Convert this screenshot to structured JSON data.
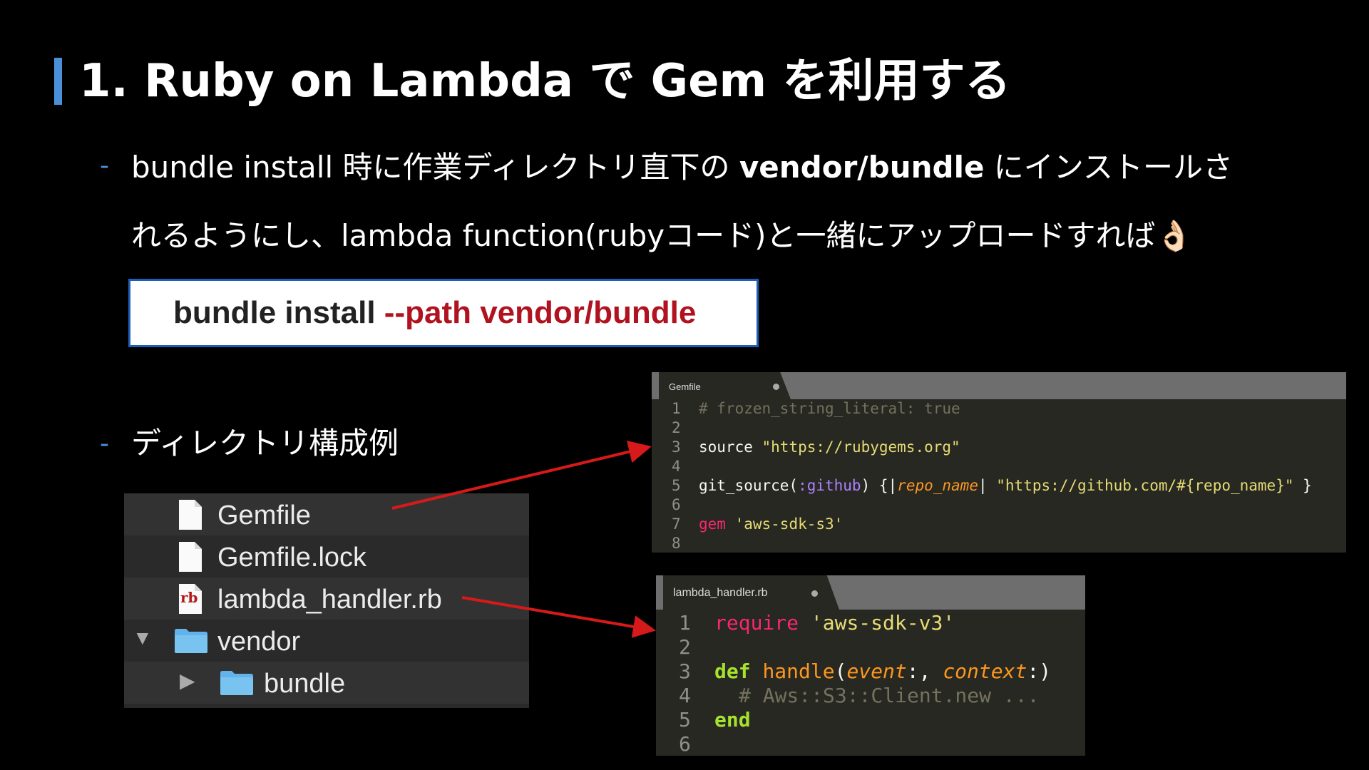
{
  "slide": {
    "title": "1. Ruby on Lambda で Gem を利用する",
    "bullet_dash": "-",
    "bullet1_line1_pre": "bundle install 時に作業ディレクトリ直下の ",
    "bullet1_line1_bold": "vendor/bundle",
    "bullet1_line1_post": " にインストールさ",
    "bullet1_line2": "れるようにし、lambda function(rubyコード)と一緒にアップロードすれば👌🏻",
    "command_base": "bundle install ",
    "command_option": "--path vendor/bundle",
    "bullet2": "ディレクトリ構成例"
  },
  "tree": {
    "items": [
      {
        "label": "Gemfile",
        "icon": "file-icon"
      },
      {
        "label": "Gemfile.lock",
        "icon": "file-icon"
      },
      {
        "label": "lambda_handler.rb",
        "icon": "ruby-file-icon",
        "badge": "rb"
      },
      {
        "label": "vendor",
        "icon": "folder-icon",
        "disclosure": "▼"
      },
      {
        "label": "bundle",
        "icon": "folder-icon",
        "disclosure": "▶"
      }
    ]
  },
  "gemfile_editor": {
    "tab_title": "Gemfile",
    "line_numbers": [
      "1",
      "2",
      "3",
      "4",
      "5",
      "6",
      "7",
      "8"
    ],
    "line1": "# frozen_string_literal: true",
    "line3_kw": "source",
    "line3_str": "\"https://rubygems.org\"",
    "line5_fn": "git_source(",
    "line5_sym": ":github",
    "line5_mid": ") {|",
    "line5_arg": "repo_name",
    "line5_pipe": "| ",
    "line5_str": "\"https://github.com/#{repo_name}\"",
    "line5_end": " }",
    "line7_kw": "gem",
    "line7_str": "'aws-sdk-s3'"
  },
  "handler_editor": {
    "tab_title": "lambda_handler.rb",
    "line_numbers": [
      "1",
      "2",
      "3",
      "4",
      "5",
      "6"
    ],
    "line1_kw": "require",
    "line1_str": "'aws-sdk-v3'",
    "line3_def": "def",
    "line3_name": "handle",
    "line3_open": "(",
    "line3_arg1": "event",
    "line3_sep": ":, ",
    "line3_arg2": "context",
    "line3_close": ":)",
    "line4": "# Aws::S3::Client.new ...",
    "line5_end": "end"
  },
  "colors": {
    "accent_blue": "#4a90d9",
    "arrow_red": "#d61a1a",
    "command_option_red": "#b1121f"
  }
}
